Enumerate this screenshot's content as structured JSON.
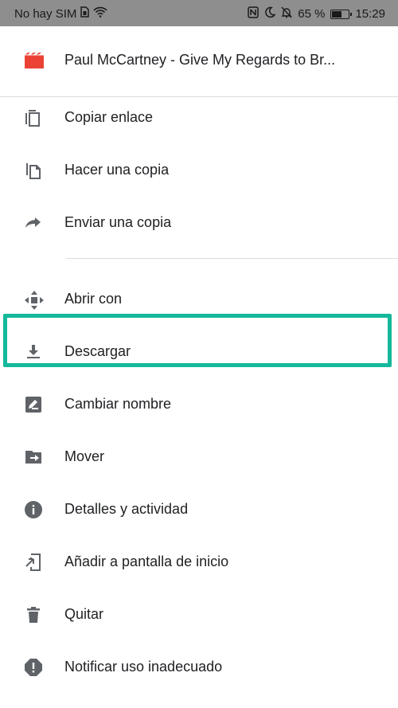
{
  "status_bar": {
    "carrier": "No hay SIM",
    "battery_percent": "65 %",
    "battery_level": 0.65,
    "time": "15:29",
    "icons": [
      "sim-icon",
      "wifi-icon",
      "nfc-icon",
      "moon-icon",
      "bell-off-icon",
      "battery-icon"
    ]
  },
  "header": {
    "title": "Paul McCartney - Give My Regards to Br...",
    "icon": "video-file-icon",
    "icon_color": "#ea4335"
  },
  "menu": {
    "items": [
      {
        "label": "Copiar enlace",
        "icon": "copy-link-icon"
      },
      {
        "label": "Hacer una copia",
        "icon": "make-copy-icon"
      },
      {
        "label": "Enviar una copia",
        "icon": "send-copy-icon"
      },
      {
        "label": "Abrir con",
        "icon": "open-with-icon"
      },
      {
        "label": "Descargar",
        "icon": "download-icon"
      },
      {
        "label": "Cambiar nombre",
        "icon": "rename-icon"
      },
      {
        "label": "Mover",
        "icon": "move-icon"
      },
      {
        "label": "Detalles y actividad",
        "icon": "info-icon"
      },
      {
        "label": "Añadir a pantalla de inicio",
        "icon": "add-to-home-icon"
      },
      {
        "label": "Quitar",
        "icon": "trash-icon"
      },
      {
        "label": "Notificar uso inadecuado",
        "icon": "report-icon"
      }
    ]
  },
  "colors": {
    "highlight": "#14b89a",
    "icon_gray": "#5f6368",
    "text": "#202124",
    "status_bar": "#8e8e8e"
  }
}
